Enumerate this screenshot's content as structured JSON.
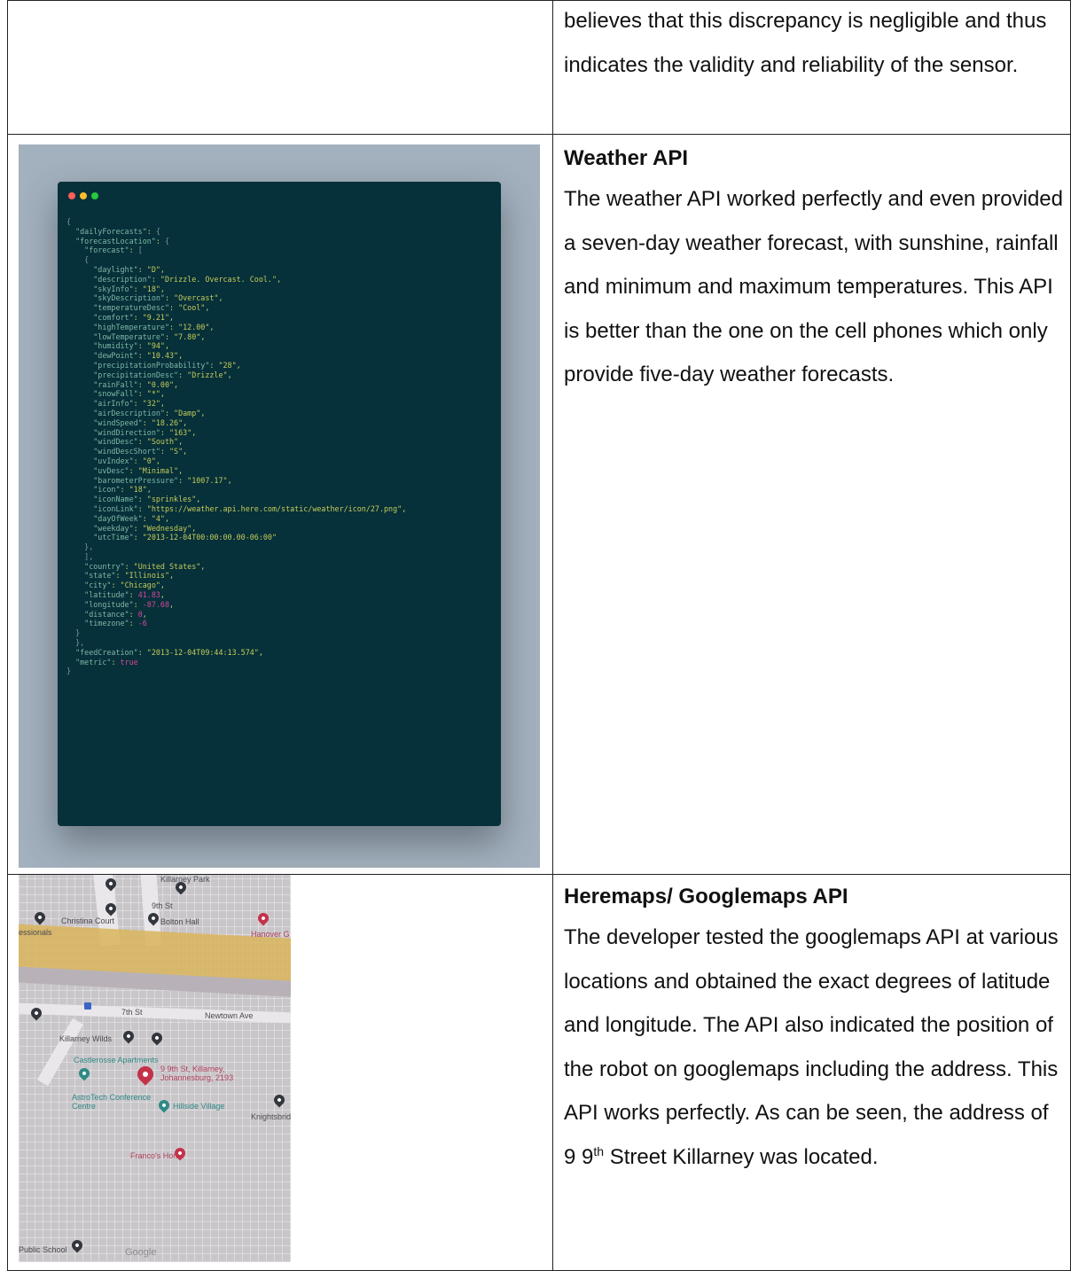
{
  "row1": {
    "text": "believes that this discrepancy is negligible and thus indicates the validity and reliability of the sensor."
  },
  "row2": {
    "heading": "Weather API",
    "body": "The weather API worked perfectly and even provided a seven-day weather forecast, with sunshine, rainfall and minimum and maximum temperatures. This API is better than the one on the cell phones which only provide five-day weather forecasts.",
    "code_window": {
      "dot_colors": [
        "#ff5f57",
        "#febc2e",
        "#28c840"
      ],
      "code_bg": "#06303a",
      "json_lines": [
        {
          "i": 0,
          "t": "{"
        },
        {
          "i": 1,
          "k": "dailyForecasts",
          "v": "{"
        },
        {
          "i": 1,
          "k": "forecastLocation",
          "v": "{"
        },
        {
          "i": 2,
          "k": "forecast",
          "v": "["
        },
        {
          "i": 2,
          "t": "{"
        },
        {
          "i": 3,
          "k": "daylight",
          "s": "D"
        },
        {
          "i": 3,
          "k": "description",
          "s": "Drizzle. Overcast. Cool."
        },
        {
          "i": 3,
          "k": "skyInfo",
          "s": "18"
        },
        {
          "i": 3,
          "k": "skyDescription",
          "s": "Overcast"
        },
        {
          "i": 3,
          "k": "temperatureDesc",
          "s": "Cool"
        },
        {
          "i": 3,
          "k": "comfort",
          "s": "9.21"
        },
        {
          "i": 3,
          "k": "highTemperature",
          "s": "12.00"
        },
        {
          "i": 3,
          "k": "lowTemperature",
          "s": "7.80"
        },
        {
          "i": 3,
          "k": "humidity",
          "s": "94"
        },
        {
          "i": 3,
          "k": "dewPoint",
          "s": "10.43"
        },
        {
          "i": 3,
          "k": "precipitationProbability",
          "s": "28"
        },
        {
          "i": 3,
          "k": "precipitationDesc",
          "s": "Drizzle"
        },
        {
          "i": 3,
          "k": "rainFall",
          "s": "0.00"
        },
        {
          "i": 3,
          "k": "snowFall",
          "s": "*"
        },
        {
          "i": 3,
          "k": "airInfo",
          "s": "32"
        },
        {
          "i": 3,
          "k": "airDescription",
          "s": "Damp"
        },
        {
          "i": 3,
          "k": "windSpeed",
          "s": "18.26"
        },
        {
          "i": 3,
          "k": "windDirection",
          "s": "163"
        },
        {
          "i": 3,
          "k": "windDesc",
          "s": "South"
        },
        {
          "i": 3,
          "k": "windDescShort",
          "s": "S"
        },
        {
          "i": 3,
          "k": "uvIndex",
          "s": "0"
        },
        {
          "i": 3,
          "k": "uvDesc",
          "s": "Minimal"
        },
        {
          "i": 3,
          "k": "barometerPressure",
          "s": "1007.17"
        },
        {
          "i": 3,
          "k": "icon",
          "s": "18"
        },
        {
          "i": 3,
          "k": "iconName",
          "s": "sprinkles"
        },
        {
          "i": 3,
          "k": "iconLink",
          "s": "https://weather.api.here.com/static/weather/icon/27.png"
        },
        {
          "i": 3,
          "k": "dayOfWeek",
          "s": "4"
        },
        {
          "i": 3,
          "k": "weekday",
          "s": "Wednesday"
        },
        {
          "i": 3,
          "k": "utcTime",
          "s": "2013-12-04T00:00:00.00-06:00",
          "last": true
        },
        {
          "i": 2,
          "t": "},"
        },
        {
          "i": 2,
          "t": "],"
        },
        {
          "i": 2,
          "k": "country",
          "s": "United States"
        },
        {
          "i": 2,
          "k": "state",
          "s": "Illinois"
        },
        {
          "i": 2,
          "k": "city",
          "s": "Chicago"
        },
        {
          "i": 2,
          "k": "latitude",
          "n": "41.83"
        },
        {
          "i": 2,
          "k": "longitude",
          "n": "-87.68"
        },
        {
          "i": 2,
          "k": "distance",
          "n": "0"
        },
        {
          "i": 2,
          "k": "timezone",
          "n": "-6",
          "last": true
        },
        {
          "i": 1,
          "t": "}"
        },
        {
          "i": 1,
          "t": "},"
        },
        {
          "i": 1,
          "k": "feedCreation",
          "s": "2013-12-04T09:44:13.574"
        },
        {
          "i": 1,
          "k": "metric",
          "n": "true",
          "last": true
        },
        {
          "i": 0,
          "t": "}"
        }
      ]
    }
  },
  "row3": {
    "heading": "Heremaps/ Googlemaps API",
    "body_main": "The developer tested the googlemaps API at various locations and obtained the exact degrees of latitude and longitude. The API also indicated the position of the robot on googlemaps including the address. This API works perfectly. As can be seen, the address of 9 9",
    "body_sup": "th",
    "body_end": " Street Killarney was located.",
    "map": {
      "labels": {
        "christina_court": "Christina Court",
        "bolton_hall": "Bolton Hall",
        "hanover": "Hanover G",
        "professionals": "essionals",
        "killarney_wilds": "Killarney Wilds",
        "castlerosse": "Castlerosse Apartments",
        "address": "9 9th St, Killarney, Johannesburg, 2193",
        "astrotech": "AstroTech Conference Centre",
        "hillside": "Hillside Village",
        "knightsbridge": "Knightsbridge",
        "francos": "Franco's Home",
        "public_school": "Public School",
        "google": "Google",
        "street_7th": "7th St",
        "street_9th": "9th St",
        "newtown": "Newtown Ave",
        "killarney_park": "Killarney Park"
      }
    }
  }
}
